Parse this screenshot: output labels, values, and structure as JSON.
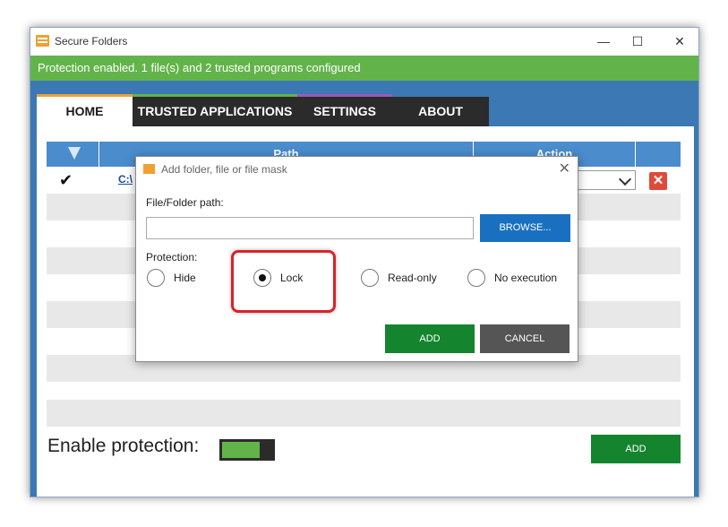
{
  "window": {
    "title": "Secure Folders",
    "minimize_glyph": "—",
    "maximize_glyph": "☐",
    "close_glyph": "✕"
  },
  "status": {
    "text": "Protection enabled. 1 file(s) and 2 trusted programs configured",
    "color": "#62b44a"
  },
  "tabs": [
    {
      "label": "HOME",
      "active": true
    },
    {
      "label": "TRUSTED APPLICATIONS"
    },
    {
      "label": "SETTINGS"
    },
    {
      "label": "ABOUT"
    }
  ],
  "table": {
    "headers": {
      "path": "Path",
      "action": "Action"
    },
    "rows": [
      {
        "checked_glyph": "✔",
        "path": "C:\\",
        "delete_glyph": "✕"
      }
    ]
  },
  "footer": {
    "enable_label": "Enable protection:",
    "toggle_on": true,
    "add_label": "ADD"
  },
  "dialog": {
    "title": "Add folder, file or file mask",
    "close_glyph": "✕",
    "path_label": "File/Folder path:",
    "path_value": "",
    "browse_label": "BROWSE...",
    "protection_label": "Protection:",
    "options": [
      {
        "label": "Hide",
        "selected": false
      },
      {
        "label": "Lock",
        "selected": true
      },
      {
        "label": "Read-only",
        "selected": false
      },
      {
        "label": "No execution",
        "selected": false
      }
    ],
    "add_label": "ADD",
    "cancel_label": "CANCEL"
  },
  "colors": {
    "accent_blue": "#3c78b4",
    "header_blue": "#4a8ccc",
    "button_green": "#14852e",
    "browse_blue": "#1a70c0",
    "highlight_red": "#d8232a"
  }
}
